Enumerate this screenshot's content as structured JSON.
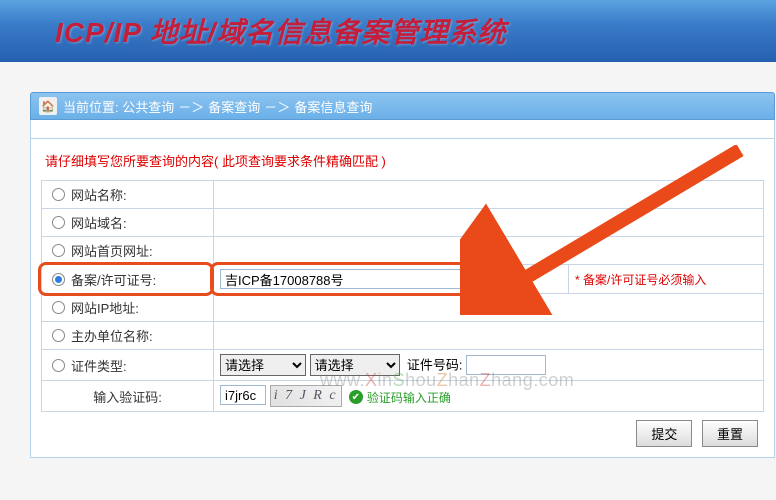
{
  "header": {
    "title": "ICP/IP 地址/域名信息备案管理系统"
  },
  "breadcrumb": {
    "label": "当前位置:",
    "l1": "公共查询",
    "l2": "备案查询",
    "l3": "备案信息查询",
    "sep": "－＞"
  },
  "instruction": "请仔细填写您所要查询的内容( 此项查询要求条件精确匹配 )",
  "rows": {
    "site_name": "网站名称:",
    "site_domain": "网站域名:",
    "site_url": "网站首页网址:",
    "icp_label": "备案/许可证号:",
    "icp_value": "吉ICP备17008788号",
    "icp_required": "* 备案/许可证号必须输入",
    "site_ip": "网站IP地址:",
    "org_name": "主办单位名称:",
    "cert_type": "证件类型:",
    "cert_no_label": "证件号码:",
    "select_placeholder": "请选择",
    "captcha_label": "输入验证码:",
    "captcha_value": "i7jr6c",
    "captcha_display": "i 7 J R c",
    "captcha_ok": "验证码输入正确"
  },
  "buttons": {
    "submit": "提交",
    "reset": "重置"
  },
  "watermark": "www.XinShouZhanZhang.com"
}
